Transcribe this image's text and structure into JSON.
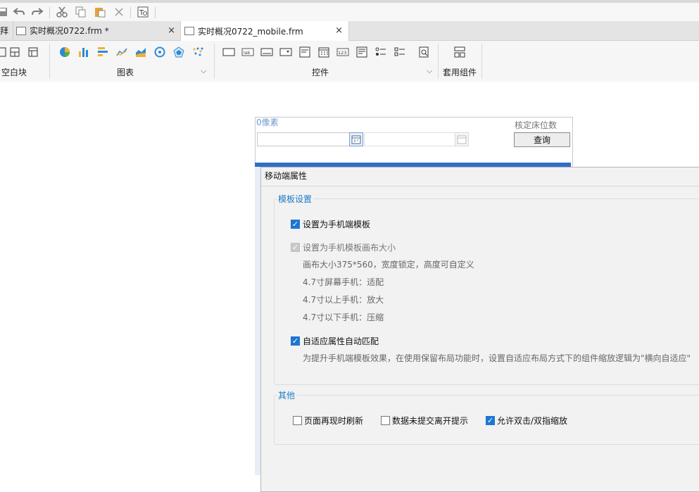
{
  "quick_toolbar": {
    "icons": [
      "save-icon",
      "undo-icon",
      "redo-icon",
      "cut-icon",
      "copy-icon",
      "paste-icon",
      "delete-icon",
      "preview-icon"
    ]
  },
  "tabs": [
    {
      "label": "拜",
      "partial": true
    },
    {
      "label": "实时概况0722.frm *",
      "close": "×"
    },
    {
      "label": "实时概况0722_mobile.frm",
      "close": "×"
    }
  ],
  "ribbon": {
    "groups": [
      {
        "label": "空白块"
      },
      {
        "label": "图表",
        "chevron": "⌵"
      },
      {
        "label": "控件",
        "chevron": "⌵"
      },
      {
        "label": "套用组件"
      }
    ],
    "control_icon_texts": {
      "label_widget": "lab",
      "number_widget": "123"
    }
  },
  "canvas": {
    "px_label": "0像素",
    "bed_label": "核定床位数",
    "query_button": "查询"
  },
  "dialog": {
    "title": "移动端属性",
    "template_group": {
      "legend": "模板设置",
      "set_mobile_template": {
        "label": "设置为手机端模板",
        "checked": true
      },
      "set_canvas_size": {
        "label": "设置为手机模板画布大小",
        "checked": true,
        "disabled": true
      },
      "canvas_size_note": "画布大小375*560，宽度锁定，高度可自定义",
      "phone_47": "4.7寸屏幕手机：适配",
      "phone_above": "4.7寸以上手机：放大",
      "phone_below": "4.7寸以下手机：压缩",
      "adaptive_match": {
        "label": "自适应属性自动匹配",
        "checked": true
      },
      "adaptive_note": "为提升手机端模板效果，在使用保留布局功能时，设置自适应布局方式下的组件缩放逻辑为\"横向自适应\""
    },
    "other_group": {
      "legend": "其他",
      "refresh_on_reappear": {
        "label": "页面再现时刷新",
        "checked": false
      },
      "unsubmitted_prompt": {
        "label": "数据未提交离开提示",
        "checked": false
      },
      "allow_zoom": {
        "label": "允许双击/双指缩放",
        "checked": true
      }
    }
  },
  "colors": {
    "accent": "#1f76d2",
    "legend": "#1e7bc4",
    "dialog_bg": "#f2f2f2"
  }
}
